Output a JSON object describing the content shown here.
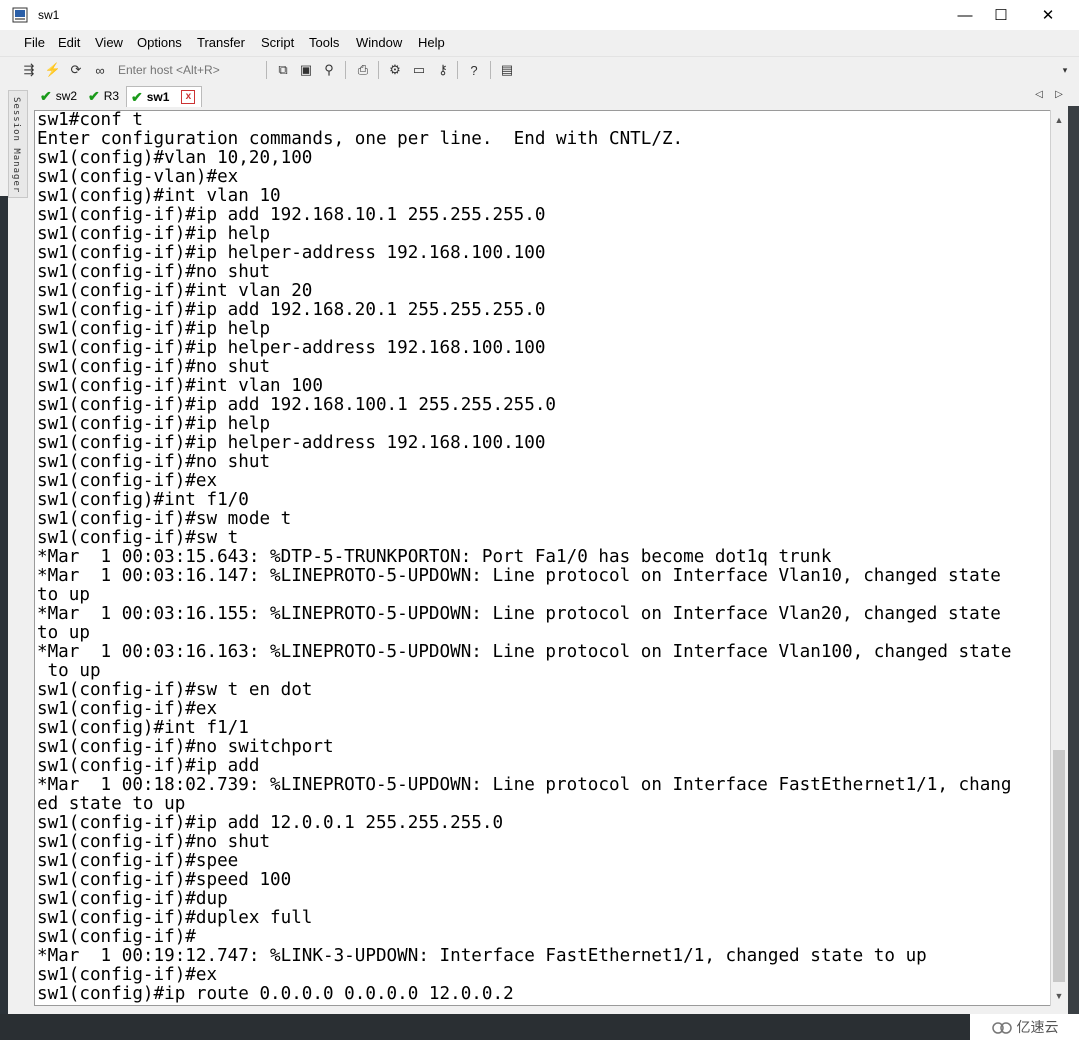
{
  "window": {
    "title": "sw1",
    "minimize": "—",
    "maximize": "☐",
    "close": "✕"
  },
  "menu": [
    {
      "label": "File"
    },
    {
      "label": "Edit"
    },
    {
      "label": "View"
    },
    {
      "label": "Options"
    },
    {
      "label": "Transfer"
    },
    {
      "label": "Script"
    },
    {
      "label": "Tools"
    },
    {
      "label": "Window"
    },
    {
      "label": "Help"
    }
  ],
  "toolbar": {
    "host_placeholder": "Enter host <Alt+R>"
  },
  "tabs": [
    {
      "label": "sw2",
      "icon": "check-icon"
    },
    {
      "label": "R3",
      "icon": "check-icon"
    },
    {
      "label": "sw1",
      "icon": "check-icon",
      "active": true
    }
  ],
  "tab_close": "x",
  "side_panel": {
    "label": "Session Manager"
  },
  "terminal": {
    "lines": [
      "sw1#conf t",
      "Enter configuration commands, one per line.  End with CNTL/Z.",
      "sw1(config)#vlan 10,20,100",
      "sw1(config-vlan)#ex",
      "sw1(config)#int vlan 10",
      "sw1(config-if)#ip add 192.168.10.1 255.255.255.0",
      "sw1(config-if)#ip help",
      "sw1(config-if)#ip helper-address 192.168.100.100",
      "sw1(config-if)#no shut",
      "sw1(config-if)#int vlan 20",
      "sw1(config-if)#ip add 192.168.20.1 255.255.255.0",
      "sw1(config-if)#ip help",
      "sw1(config-if)#ip helper-address 192.168.100.100",
      "sw1(config-if)#no shut",
      "sw1(config-if)#int vlan 100",
      "sw1(config-if)#ip add 192.168.100.1 255.255.255.0",
      "sw1(config-if)#ip help",
      "sw1(config-if)#ip helper-address 192.168.100.100",
      "sw1(config-if)#no shut",
      "sw1(config-if)#ex",
      "sw1(config)#int f1/0",
      "sw1(config-if)#sw mode t",
      "sw1(config-if)#sw t",
      "*Mar  1 00:03:15.643: %DTP-5-TRUNKPORTON: Port Fa1/0 has become dot1q trunk",
      "*Mar  1 00:03:16.147: %LINEPROTO-5-UPDOWN: Line protocol on Interface Vlan10, changed state",
      "to up",
      "*Mar  1 00:03:16.155: %LINEPROTO-5-UPDOWN: Line protocol on Interface Vlan20, changed state",
      "to up",
      "*Mar  1 00:03:16.163: %LINEPROTO-5-UPDOWN: Line protocol on Interface Vlan100, changed state",
      " to up",
      "sw1(config-if)#sw t en dot",
      "sw1(config-if)#ex",
      "sw1(config)#int f1/1",
      "sw1(config-if)#no switchport",
      "sw1(config-if)#ip add",
      "*Mar  1 00:18:02.739: %LINEPROTO-5-UPDOWN: Line protocol on Interface FastEthernet1/1, chang",
      "ed state to up",
      "sw1(config-if)#ip add 12.0.0.1 255.255.255.0",
      "sw1(config-if)#no shut",
      "sw1(config-if)#spee",
      "sw1(config-if)#speed 100",
      "sw1(config-if)#dup",
      "sw1(config-if)#duplex full",
      "sw1(config-if)#",
      "*Mar  1 00:19:12.747: %LINK-3-UPDOWN: Interface FastEthernet1/1, changed state to up",
      "sw1(config-if)#ex",
      "sw1(config)#ip route 0.0.0.0 0.0.0.0 12.0.0.2"
    ]
  },
  "watermark": {
    "text": "亿速云"
  }
}
